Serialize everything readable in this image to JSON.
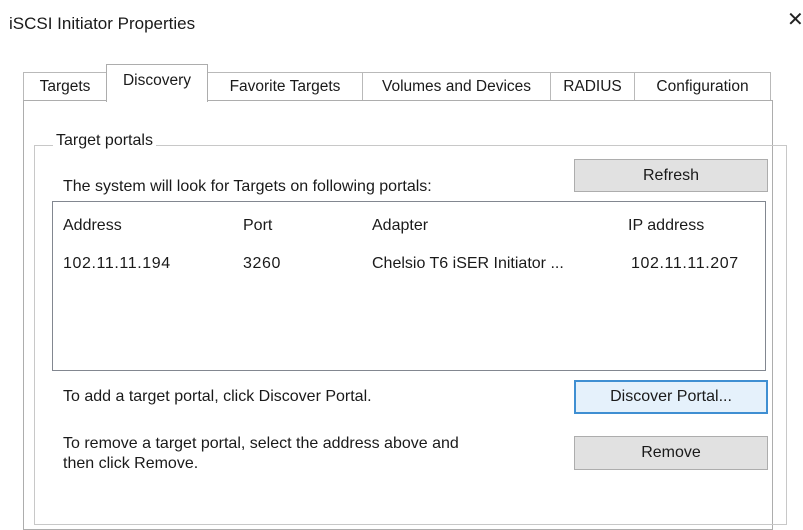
{
  "window": {
    "title": "iSCSI Initiator Properties",
    "close_glyph": "✕"
  },
  "tabs": [
    {
      "label": "Targets",
      "active": false
    },
    {
      "label": "Discovery",
      "active": true
    },
    {
      "label": "Favorite Targets",
      "active": false
    },
    {
      "label": "Volumes and Devices",
      "active": false
    },
    {
      "label": "RADIUS",
      "active": false
    },
    {
      "label": "Configuration",
      "active": false
    }
  ],
  "discovery": {
    "group_label": "Target portals",
    "portals_caption": "The system will look for Targets on following portals:",
    "refresh_label": "Refresh",
    "columns": [
      "Address",
      "Port",
      "Adapter",
      "IP address"
    ],
    "rows": [
      {
        "address": "102.11.11.194",
        "port": "3260",
        "adapter": "Chelsio T6 iSER Initiator ...",
        "ip": "102.11.11.207"
      }
    ],
    "add_hint": "To add a target portal, click Discover Portal.",
    "discover_label": "Discover Portal...",
    "remove_hint_line1": "To remove a target portal, select the address above and",
    "remove_hint_line2": "then click Remove.",
    "remove_label": "Remove"
  }
}
